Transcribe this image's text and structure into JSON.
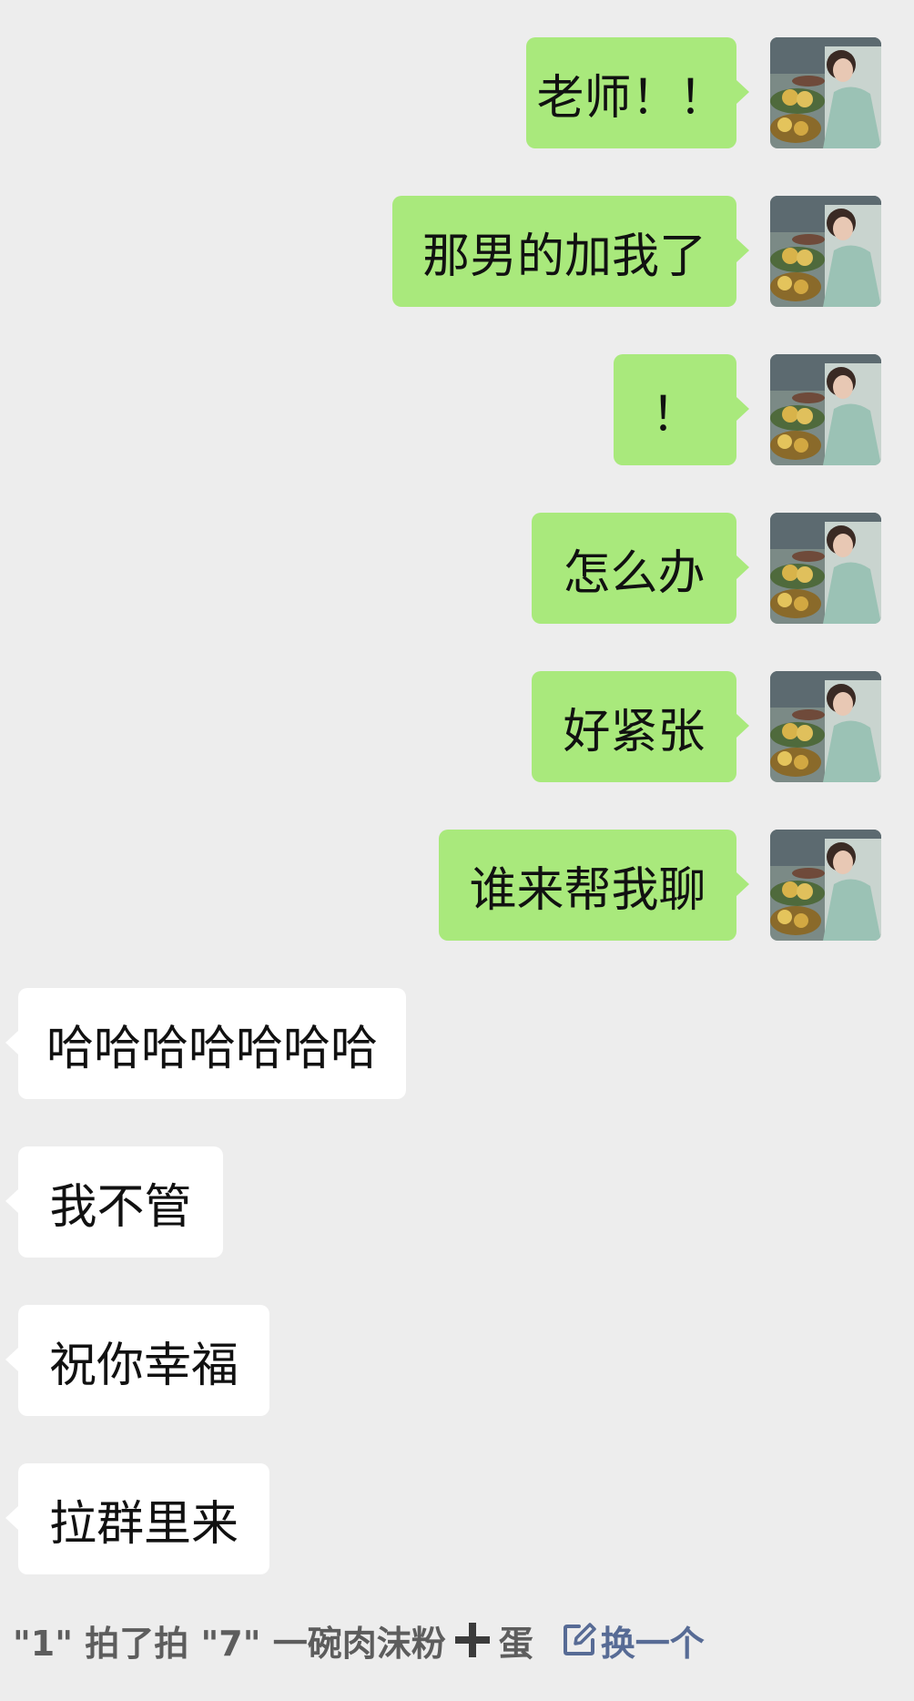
{
  "conversation": {
    "outgoing": [
      {
        "text": "老师！！"
      },
      {
        "text": "那男的加我了"
      },
      {
        "text": "！"
      },
      {
        "text": "怎么办"
      },
      {
        "text": "好紧张"
      },
      {
        "text": "谁来帮我聊"
      }
    ],
    "incoming": [
      {
        "text": "哈哈哈哈哈哈哈"
      },
      {
        "text": "我不管"
      },
      {
        "text": "祝你幸福"
      },
      {
        "text": "拉群里来"
      }
    ]
  },
  "pat_notice": {
    "text_before": "\"1\" 拍了拍 \"7\" 一碗肉沫粉",
    "text_after": "蛋",
    "plus_icon": "plus-icon",
    "change_label": "换一个",
    "change_icon": "edit-icon"
  },
  "colors": {
    "background": "#ededed",
    "outgoing_bubble": "#a9e97c",
    "incoming_bubble": "#ffffff",
    "link": "#576b95"
  }
}
